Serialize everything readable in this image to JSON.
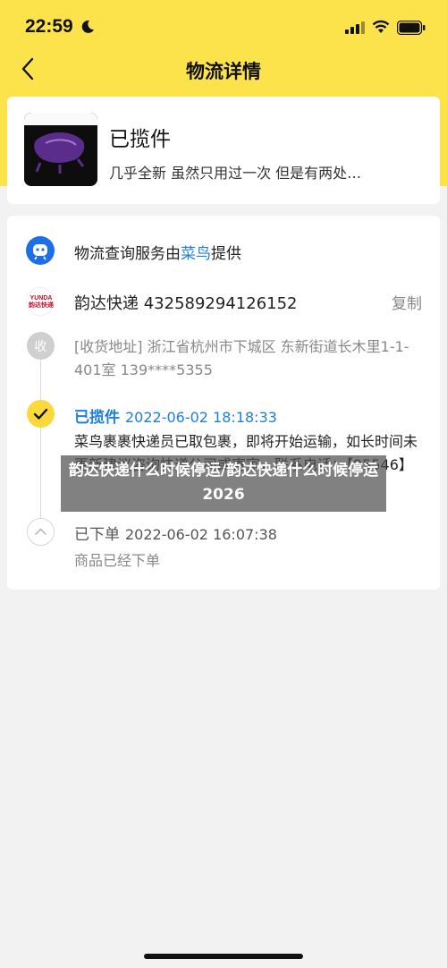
{
  "status_bar": {
    "time": "22:59"
  },
  "nav": {
    "title": "物流详情"
  },
  "product": {
    "status": "已揽件",
    "description": "几乎全新 虽然只用过一次 但是有两处…"
  },
  "provider": {
    "prefix": "物流查询服务由",
    "highlight": "菜鸟",
    "suffix": "提供"
  },
  "courier": {
    "logo_text": "YUNDA 韵达快递",
    "label": "韵达快递 432589294126152",
    "copy_label": "复制"
  },
  "timeline": {
    "receive_node": "收",
    "address": "[收货地址] 浙江省杭州市下城区 东新街道长木里1-1-401室 139****5355",
    "pickup_status": "已揽件",
    "pickup_time": "2022-06-02 18:18:33",
    "pickup_desc": "菜鸟裹裹快递员已取包裹，即将开始运输，如长时间未更新建议咨询快递公司或寄家，联系电话：【95546】",
    "order_status": "已下单",
    "order_time": "2022-06-02 16:07:38",
    "order_desc": "商品已经下单"
  },
  "overlay": {
    "text": "韵达快递什么时候停运/韵达快递什么时候停运2026"
  },
  "colors": {
    "accent_yellow": "#fde34b",
    "link_blue": "#1e7fe0"
  }
}
